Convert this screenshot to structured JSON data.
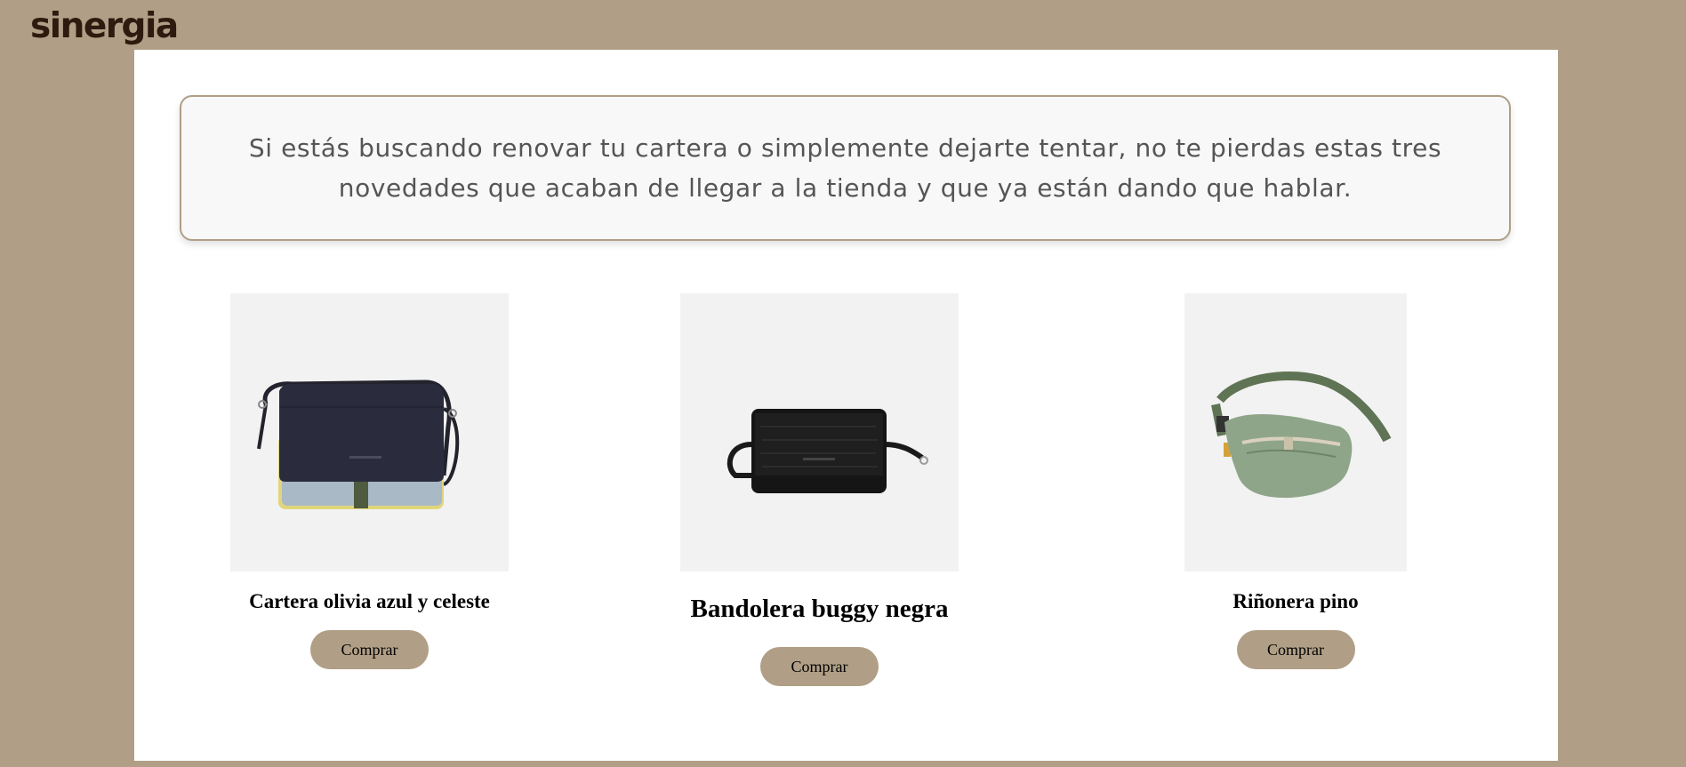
{
  "header": {
    "logo_text": "sinergia"
  },
  "intro": {
    "text": "Si estás buscando renovar tu cartera o simplemente dejarte tentar, no te pierdas estas tres novedades que acaban de llegar a la tienda y que ya están dando que hablar."
  },
  "products": [
    {
      "name": "Cartera olivia azul y celeste",
      "button_label": "Comprar",
      "image_icon": "crossbody-bag-navy-lightblue-image"
    },
    {
      "name": "Bandolera buggy negra",
      "button_label": "Comprar",
      "image_icon": "black-bandolera-bag-image"
    },
    {
      "name": "Riñonera pino",
      "button_label": "Comprar",
      "image_icon": "green-fanny-pack-image"
    }
  ],
  "colors": {
    "page_background": "#b09f86",
    "button_background": "#b09f86",
    "logo": "#2e1a0e",
    "panel": "#ffffff",
    "image_background": "#f2f2f2"
  }
}
